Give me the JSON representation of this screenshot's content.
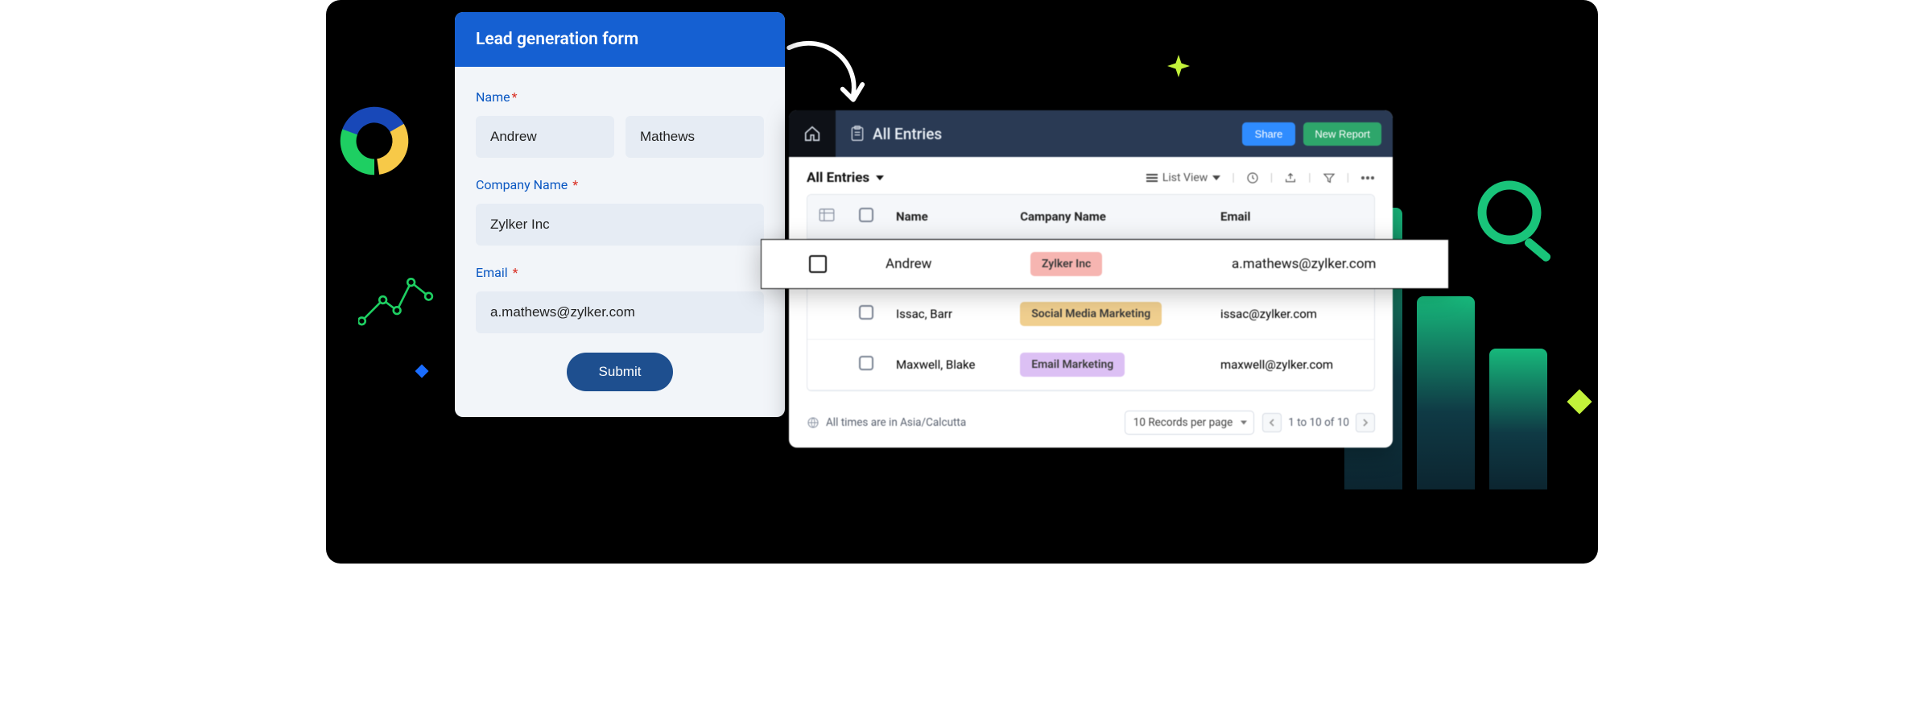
{
  "form": {
    "title": "Lead generation form",
    "name_label": "Name",
    "company_label": "Company Name",
    "email_label": "Email",
    "first_name": "Andrew",
    "last_name": "Mathews",
    "company": "Zylker Inc",
    "email": "a.mathews@zylker.com",
    "submit": "Submit"
  },
  "entries": {
    "topbar_title": "All Entries",
    "share": "Share",
    "new_report": "New Report",
    "dropdown_title": "All Entries",
    "view_label": "List View",
    "columns": {
      "name": "Name",
      "company": "Campany Name",
      "email": "Email"
    },
    "highlight": {
      "name": "Andrew",
      "company": "Zylker Inc",
      "email": "a.mathews@zylker.com"
    },
    "rows": [
      {
        "name": "Issac, Barr",
        "company": "Social Media Marketing",
        "company_chip": "orange",
        "email": "issac@zylker.com"
      },
      {
        "name": "Maxwell, Blake",
        "company": "Email Marketing",
        "company_chip": "purple",
        "email": "maxwell@zylker.com"
      }
    ],
    "timezone_note": "All times are in Asia/Calcutta",
    "records_per_page": "10 Records per page",
    "pager_text": "1 to 10 of 10"
  }
}
